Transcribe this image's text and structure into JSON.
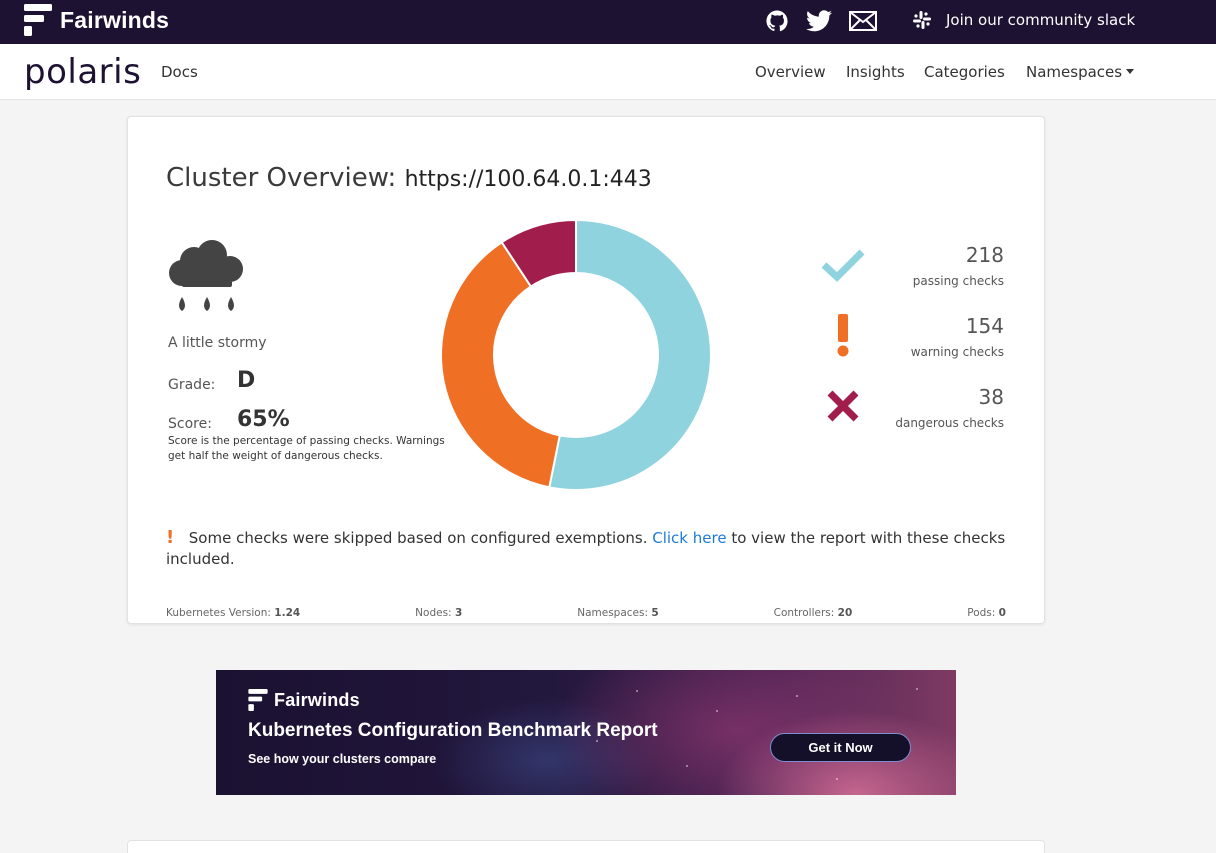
{
  "topbar": {
    "brand": "Fairwinds",
    "icons": [
      "github-icon",
      "twitter-icon",
      "mail-icon",
      "slack-icon"
    ],
    "slack_label": "Join our community slack"
  },
  "navbar": {
    "logo": "polaris",
    "docs": "Docs",
    "links": [
      "Overview",
      "Insights",
      "Categories",
      "Namespaces"
    ]
  },
  "cluster": {
    "title_prefix": "Cluster Overview:",
    "url": "https://100.64.0.1:443",
    "weather_icon": "stormy-cloud-icon",
    "weather_label": "A little stormy",
    "grade_label": "Grade:",
    "grade": "D",
    "score_label": "Score:",
    "score": "65%",
    "score_note": "Score is the percentage of passing checks. Warnings get half the weight of dangerous checks."
  },
  "checks": {
    "passing": {
      "count": "218",
      "label": "passing checks",
      "color": "#8fd3de",
      "icon": "check-icon"
    },
    "warning": {
      "count": "154",
      "label": "warning checks",
      "color": "#ef7025",
      "icon": "exclamation-icon"
    },
    "dangerous": {
      "count": "38",
      "label": "dangerous checks",
      "color": "#a11d4b",
      "icon": "x-icon"
    }
  },
  "chart_data": {
    "type": "pie",
    "categories": [
      "passing checks",
      "warning checks",
      "dangerous checks"
    ],
    "values": [
      218,
      154,
      38
    ],
    "colors": [
      "#8fd3de",
      "#ef7025",
      "#a11d4b"
    ]
  },
  "notice": {
    "before": "Some checks were skipped based on configured exemptions.",
    "link": "Click here",
    "after": "to view the report with these checks included."
  },
  "footer": {
    "kubernetes_label": "Kubernetes Version:",
    "kubernetes": "1.24",
    "nodes_label": "Nodes:",
    "nodes": "3",
    "namespaces_label": "Namespaces:",
    "namespaces": "5",
    "controllers_label": "Controllers:",
    "controllers": "20",
    "pods_label": "Pods:",
    "pods": "0"
  },
  "banner": {
    "brand": "Fairwinds",
    "title": "Kubernetes Configuration Benchmark Report",
    "subtitle": "See how your clusters compare",
    "button": "Get it Now"
  }
}
